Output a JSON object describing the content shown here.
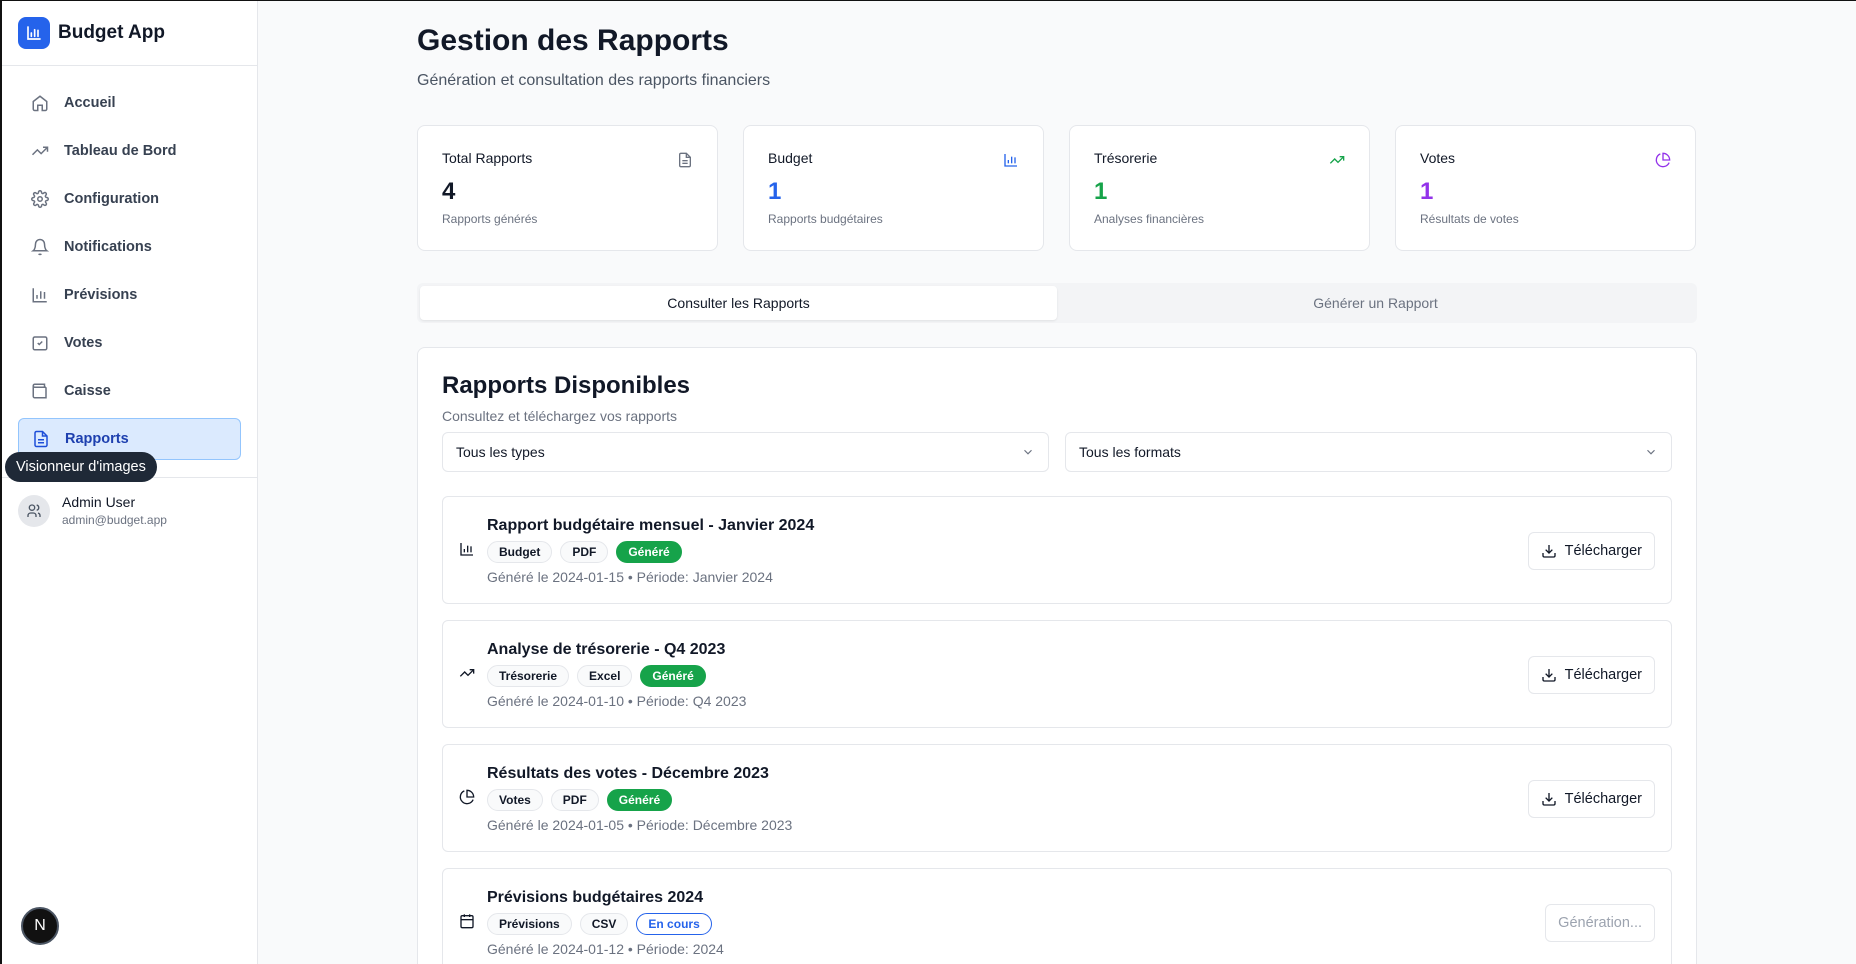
{
  "app": {
    "name": "Budget App"
  },
  "sidebar": {
    "items": [
      {
        "label": "Accueil",
        "icon": "home-icon"
      },
      {
        "label": "Tableau de Bord",
        "icon": "trending-up-icon"
      },
      {
        "label": "Configuration",
        "icon": "gear-icon"
      },
      {
        "label": "Notifications",
        "icon": "bell-icon"
      },
      {
        "label": "Prévisions",
        "icon": "bar-chart-icon"
      },
      {
        "label": "Votes",
        "icon": "check-square-icon"
      },
      {
        "label": "Caisse",
        "icon": "wallet-icon"
      },
      {
        "label": "Rapports",
        "icon": "file-text-icon",
        "active": true
      }
    ],
    "user": {
      "name": "Admin User",
      "email": "admin@budget.app"
    },
    "tooltip": "Visionneur d'images",
    "dev_badge": "N"
  },
  "header": {
    "title": "Gestion des Rapports",
    "subtitle": "Génération et consultation des rapports financiers"
  },
  "stats": [
    {
      "label": "Total Rapports",
      "value": "4",
      "desc": "Rapports générés",
      "color": "#111827",
      "icon": "file-text-icon"
    },
    {
      "label": "Budget",
      "value": "1",
      "desc": "Rapports budgétaires",
      "color": "#2563eb",
      "icon": "bar-chart-icon"
    },
    {
      "label": "Trésorerie",
      "value": "1",
      "desc": "Analyses financières",
      "color": "#16a34a",
      "icon": "trending-up-icon"
    },
    {
      "label": "Votes",
      "value": "1",
      "desc": "Résultats de votes",
      "color": "#9333ea",
      "icon": "pie-chart-icon"
    }
  ],
  "tabs": [
    {
      "label": "Consulter les Rapports",
      "active": true
    },
    {
      "label": "Générer un Rapport",
      "active": false
    }
  ],
  "reports_card": {
    "title": "Rapports Disponibles",
    "subtitle": "Consultez et téléchargez vos rapports",
    "filter_type": "Tous les types",
    "filter_format": "Tous les formats"
  },
  "reports": [
    {
      "title": "Rapport budgétaire mensuel - Janvier 2024",
      "type": "Budget",
      "format": "PDF",
      "status": "Généré",
      "meta": "Généré le 2024-01-15 • Période: Janvier 2024",
      "action": "Télécharger",
      "icon": "bar-chart-icon"
    },
    {
      "title": "Analyse de trésorerie - Q4 2023",
      "type": "Trésorerie",
      "format": "Excel",
      "status": "Généré",
      "meta": "Généré le 2024-01-10 • Période: Q4 2023",
      "action": "Télécharger",
      "icon": "trending-up-icon"
    },
    {
      "title": "Résultats des votes - Décembre 2023",
      "type": "Votes",
      "format": "PDF",
      "status": "Généré",
      "meta": "Généré le 2024-01-05 • Période: Décembre 2023",
      "action": "Télécharger",
      "icon": "pie-chart-icon"
    },
    {
      "title": "Prévisions budgétaires 2024",
      "type": "Prévisions",
      "format": "CSV",
      "status": "En cours",
      "meta": "Généré le 2024-01-12 • Période: 2024",
      "action": "Génération...",
      "icon": "calendar-icon"
    }
  ]
}
